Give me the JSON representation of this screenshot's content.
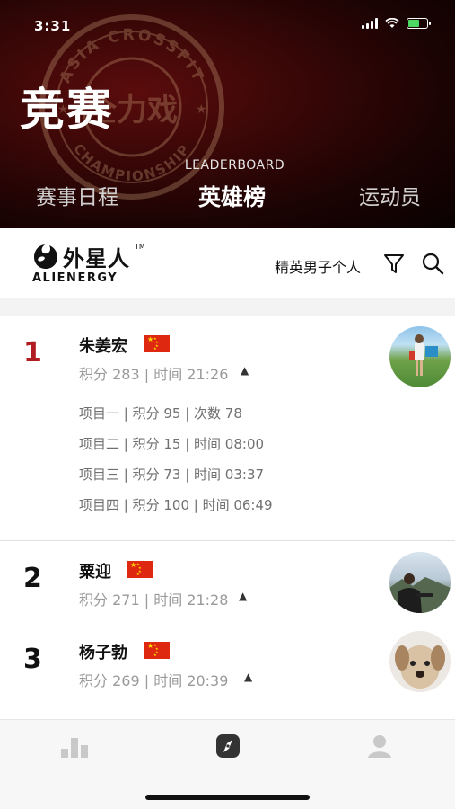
{
  "status_bar": {
    "time": "3:31"
  },
  "hero": {
    "title": "竞赛",
    "seal_text_top": "ASIA CROSSFIT",
    "seal_text_bottom": "CHAMPIONSHIP",
    "seal_center": "全力戏",
    "active_tab_subtitle": "LEADERBOARD",
    "tabs": [
      {
        "label": "赛事日程",
        "active": false
      },
      {
        "label": "英雄榜",
        "active": true
      },
      {
        "label": "运动员",
        "active": false
      }
    ]
  },
  "brand": {
    "logo_cn": "外星人",
    "logo_tm": "TM",
    "logo_en": "ALIENERGY",
    "division_filter": "精英男子个人",
    "icons": {
      "filter": "filter-icon",
      "search": "search-icon"
    }
  },
  "leaderboard": [
    {
      "rank": "1",
      "name": "朱姜宏",
      "flag": "china-flag",
      "summary": "积分 283 | 时间 21:26",
      "expanded": true,
      "events": [
        "项目一 | 积分 95 | 次数 78",
        "项目二 | 积分 15 | 时间 08:00",
        "项目三 | 积分 73 | 时间 03:37",
        "项目四 | 积分 100 | 时间 06:49"
      ]
    },
    {
      "rank": "2",
      "name": "粟迎",
      "flag": "china-flag",
      "summary": "积分 271 | 时间 21:28",
      "expanded": false
    },
    {
      "rank": "3",
      "name": "杨子勃",
      "flag": "china-flag",
      "summary": "积分 269 | 时间 20:39",
      "expanded": false
    }
  ],
  "tabbar": {
    "items": [
      {
        "icon": "chart-icon",
        "active": false
      },
      {
        "icon": "compass-icon",
        "active": true
      },
      {
        "icon": "profile-icon",
        "active": false
      }
    ]
  },
  "colors": {
    "hero_dark": "#1a0303",
    "hero_red": "#5a0c0c",
    "rank_first": "#b01c22",
    "flag_red": "#de2910",
    "flag_star": "#ffde00"
  }
}
